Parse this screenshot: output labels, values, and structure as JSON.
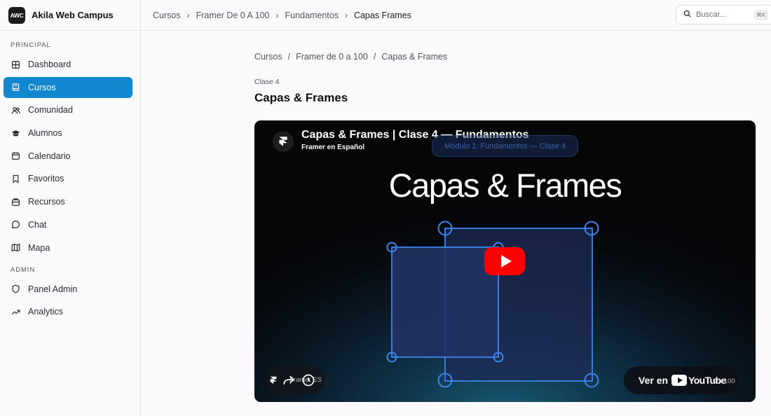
{
  "brand": {
    "logo": "AWC",
    "name": "Akila Web Campus"
  },
  "sidebar": {
    "sections": [
      {
        "label": "PRINCIPAL",
        "items": [
          {
            "label": "Dashboard",
            "icon": "dashboard-icon",
            "active": false
          },
          {
            "label": "Cursos",
            "icon": "book-icon",
            "active": true
          },
          {
            "label": "Comunidad",
            "icon": "users-icon",
            "active": false
          },
          {
            "label": "Alumnos",
            "icon": "graduation-cap-icon",
            "active": false
          },
          {
            "label": "Calendario",
            "icon": "calendar-icon",
            "active": false
          },
          {
            "label": "Favoritos",
            "icon": "bookmark-icon",
            "active": false
          },
          {
            "label": "Recursos",
            "icon": "package-icon",
            "active": false
          },
          {
            "label": "Chat",
            "icon": "chat-icon",
            "active": false
          },
          {
            "label": "Mapa",
            "icon": "map-icon",
            "active": false
          }
        ]
      },
      {
        "label": "ADMIN",
        "items": [
          {
            "label": "Panel Admin",
            "icon": "shield-icon",
            "active": false
          },
          {
            "label": "Analytics",
            "icon": "trending-up-icon",
            "active": false
          }
        ]
      }
    ],
    "active_color": "#1286cf"
  },
  "topbar": {
    "breadcrumbs": [
      "Cursos",
      "Framer De 0 A 100",
      "Fundamentos",
      "Capas Frames"
    ],
    "search": {
      "placeholder": "Buscar...",
      "shortcut": "⌘K"
    }
  },
  "content": {
    "breadcrumbs": [
      "Cursos",
      "Framer de 0 a 100",
      "Capas & Frames"
    ],
    "overline": "Clase 4",
    "title": "Capas & Frames"
  },
  "video": {
    "title": "Capas & Frames | Clase 4 — Fundamentos",
    "channel": "Framer en Español",
    "module_pill": "Módulo 1: Fundamentos — Clase 4",
    "headline": "Capas & Frames",
    "bottom_left_text": "Framer ES",
    "watch_label": "Ver en",
    "youtube_word": "YouTube",
    "watch_sub": "0 a 100",
    "play_color": "#ff0000"
  }
}
